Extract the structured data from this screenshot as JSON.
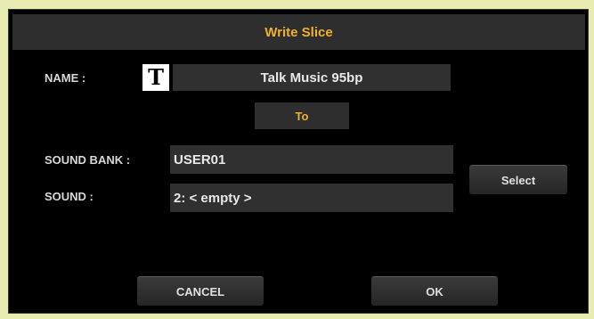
{
  "dialog": {
    "title": "Write Slice",
    "name_label": "NAME :",
    "name_value": "Talk Music 95bp",
    "text_icon": "T",
    "to_label": "To",
    "sound_bank_label": "SOUND BANK :",
    "sound_bank_value": "USER01",
    "sound_label": "SOUND :",
    "sound_value": "2: < empty >",
    "select_label": "Select",
    "cancel_label": "CANCEL",
    "ok_label": "OK"
  },
  "colors": {
    "accent": "#f0b030",
    "background": "#000000",
    "field": "#303030",
    "frame": "#e8ecb0"
  }
}
